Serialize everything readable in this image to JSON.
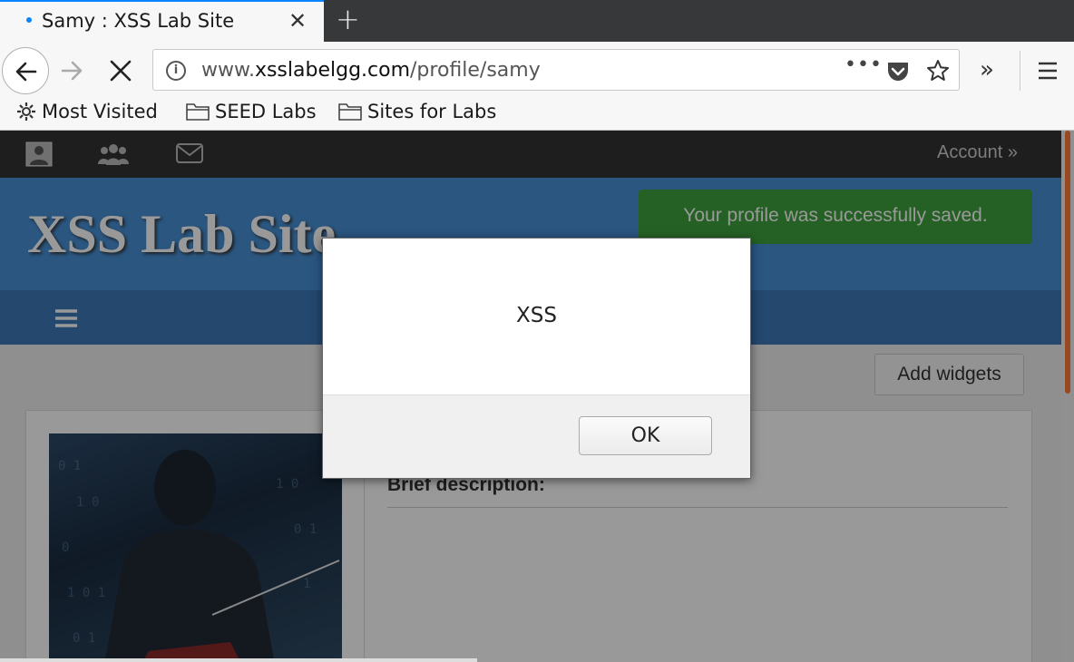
{
  "browser": {
    "tab_title": "Samy : XSS Lab Site",
    "tab_close": "✕",
    "new_tab": "+",
    "url_host_pre": "www.",
    "url_host": "xsslabelgg.com",
    "url_path": "/profile/samy",
    "page_actions": "•••",
    "overflow": "»",
    "accent_color": "#0a84ff"
  },
  "bookmarks": [
    {
      "label": "Most Visited",
      "icon": "gear-icon"
    },
    {
      "label": "SEED Labs",
      "icon": "folder-icon"
    },
    {
      "label": "Sites for Labs",
      "icon": "folder-icon"
    }
  ],
  "site": {
    "account_label": "Account »",
    "title": "XSS Lab Site",
    "success_message": "Your profile was successfully saved.",
    "add_widgets_label": "Add widgets",
    "brief_description_label": "Brief description:",
    "header_color": "#4690d6",
    "success_color": "#3ea23e"
  },
  "dialog": {
    "message": "XSS",
    "ok_label": "OK"
  }
}
